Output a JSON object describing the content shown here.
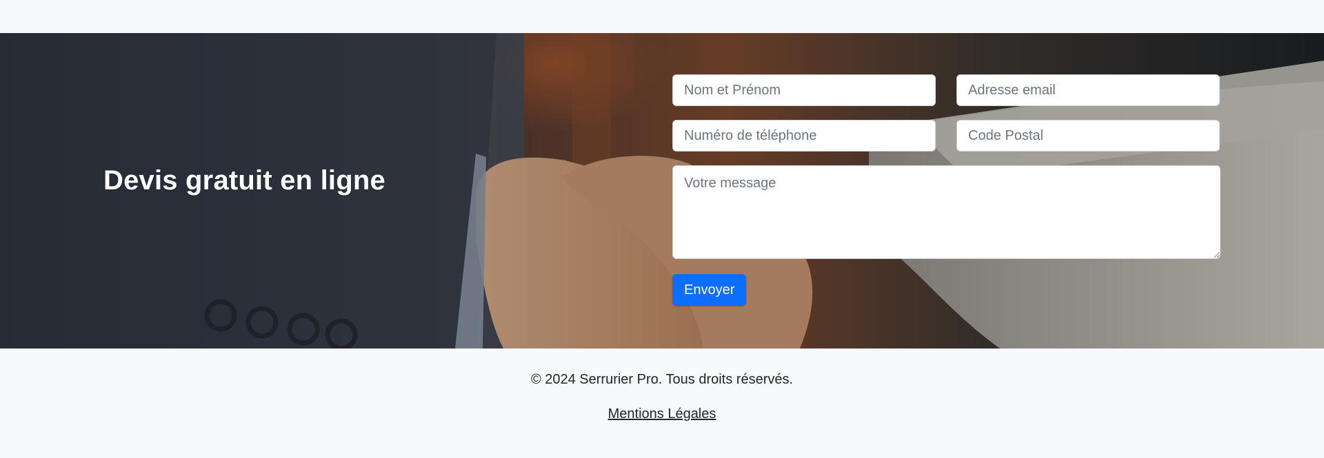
{
  "hero": {
    "title": "Devis gratuit en ligne"
  },
  "form": {
    "fields": {
      "name_placeholder": "Nom et Prénom",
      "email_placeholder": "Adresse email",
      "phone_placeholder": "Numéro de téléphone",
      "postal_placeholder": "Code Postal",
      "message_placeholder": "Votre message"
    },
    "submit_label": "Envoyer"
  },
  "footer": {
    "copyright": "© 2024 Serrurier Pro. Tous droits réservés.",
    "legal_link": "Mentions Légales"
  },
  "colors": {
    "page_bg": "#f8f9fa",
    "primary_button": "#0d6efd",
    "hero_title": "#ffffff"
  }
}
